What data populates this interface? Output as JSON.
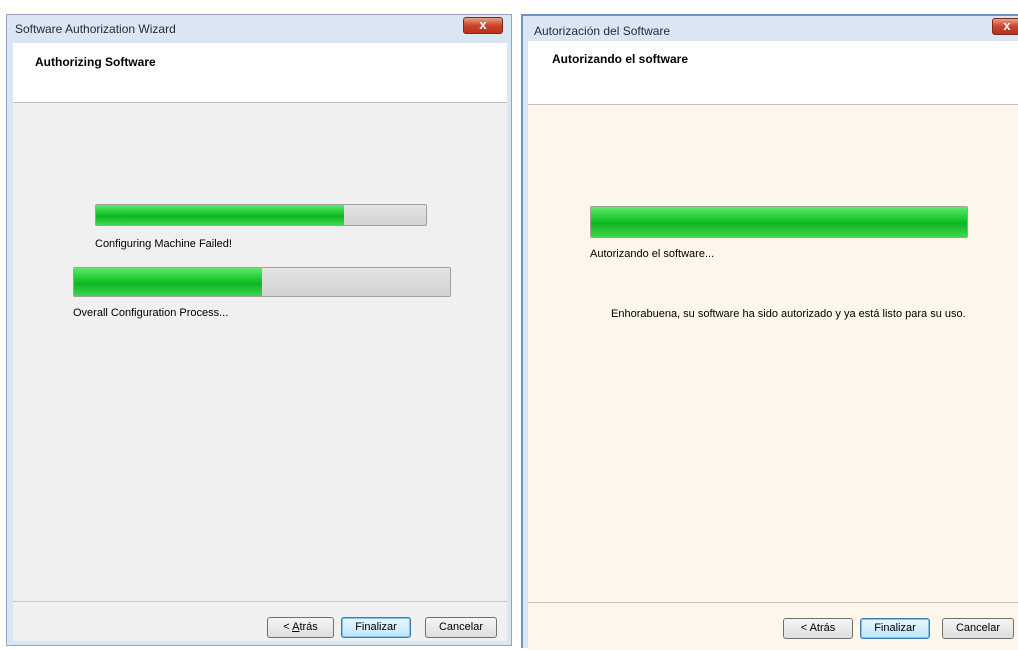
{
  "left_window": {
    "title": "Software Authorization Wizard",
    "close_glyph": "x",
    "header_title": "Authorizing Software",
    "progress1": {
      "fraction": 0.75,
      "label": "Configuring Machine Failed!"
    },
    "progress2": {
      "fraction": 0.5,
      "label": "Overall Configuration Process..."
    },
    "buttons": {
      "back_prefix": "< ",
      "back_mnemonic": "A",
      "back_rest": "trás",
      "finish": "Finalizar",
      "cancel": "Cancelar"
    }
  },
  "right_window": {
    "title": "Autorización del Software",
    "close_glyph": "x",
    "header_title": "Autorizando el software",
    "progress": {
      "fraction": 1.0,
      "label": "Autorizando el software..."
    },
    "message": "Enhorabuena, su software ha sido autorizado y ya está listo para su uso.",
    "buttons": {
      "back": "< Atrás",
      "finish": "Finalizar",
      "cancel": "Cancelar"
    }
  },
  "colors": {
    "progress_green": "#16c52a",
    "left_body_bg": "#f0f0f0",
    "right_body_bg": "#fcf7ea",
    "title_bar_bg": "#dbe6f3"
  }
}
